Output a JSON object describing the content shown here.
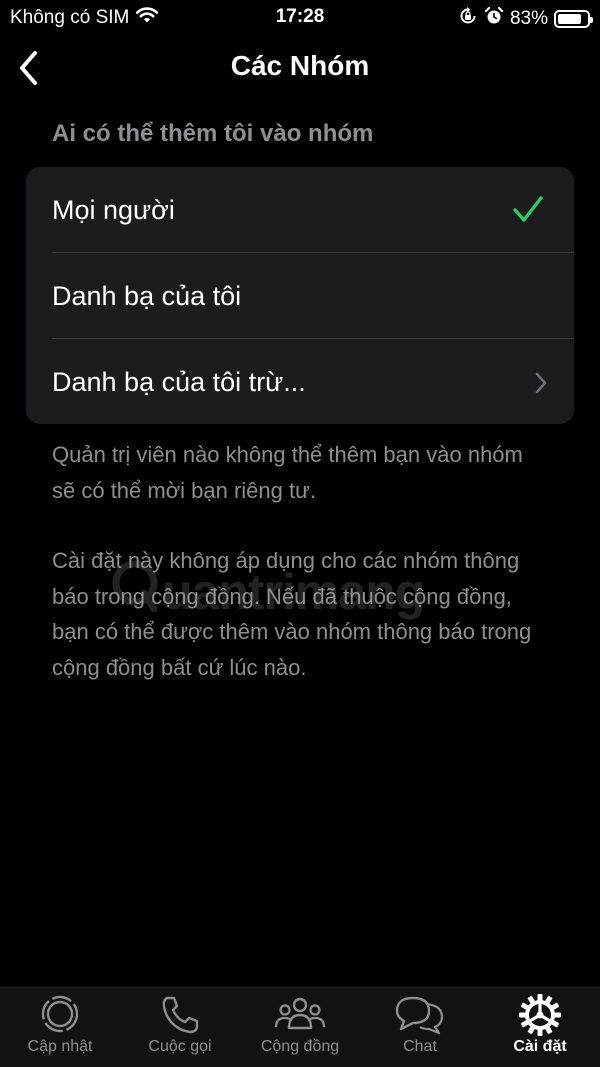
{
  "status_bar": {
    "carrier": "Không có SIM",
    "time": "17:28",
    "battery": "83%",
    "battery_level": 0.83,
    "icons": [
      "wifi-icon",
      "rotation-lock-icon",
      "alarm-icon",
      "battery-icon"
    ]
  },
  "nav": {
    "title": "Các Nhóm",
    "back_icon": "chevron-left-icon"
  },
  "section": {
    "header": "Ai có thể thêm tôi vào nhóm",
    "options": [
      {
        "label": "Mọi người",
        "selected": true
      },
      {
        "label": "Danh bạ của tôi",
        "selected": false
      },
      {
        "label": "Danh bạ của tôi trừ...",
        "selected": false,
        "has_chevron": true
      }
    ]
  },
  "notes": {
    "note1": "Quản trị viên nào không thể thêm bạn vào nhóm sẽ có thể mời bạn riêng tư.",
    "note2": "Cài đặt này không áp dụng cho các nhóm thông báo trong cộng đồng. Nếu đã thuộc cộng đồng, bạn có thể được thêm vào nhóm thông báo trong cộng đồng bất cứ lúc nào."
  },
  "watermark": {
    "text": "uantrimang"
  },
  "tabs": [
    {
      "label": "Cập nhật",
      "icon": "status-icon",
      "active": false
    },
    {
      "label": "Cuộc gọi",
      "icon": "phone-icon",
      "active": false
    },
    {
      "label": "Cộng đồng",
      "icon": "community-icon",
      "active": false
    },
    {
      "label": "Chat",
      "icon": "chat-icon",
      "active": false
    },
    {
      "label": "Cài đặt",
      "icon": "settings-icon",
      "active": true
    }
  ],
  "colors": {
    "background": "#000000",
    "card": "#1c1c1e",
    "secondary_text": "#8e8e93",
    "check": "#25d366"
  }
}
